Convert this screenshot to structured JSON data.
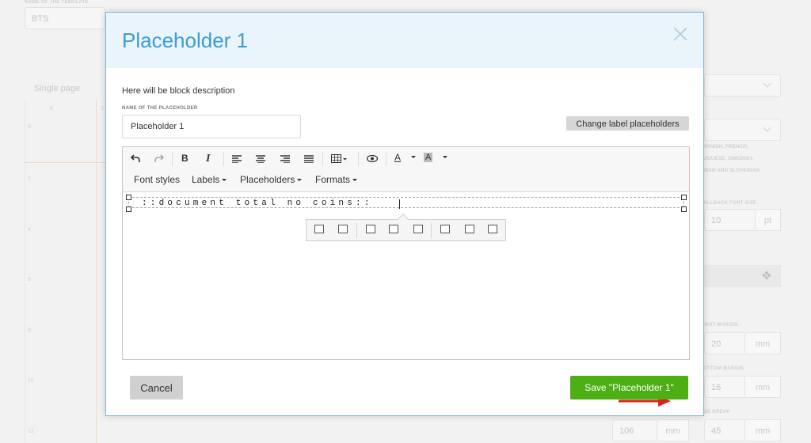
{
  "background": {
    "template_name_label": "NAME OF THE TEMPLATE",
    "template_name_value": "BTS",
    "page_mode": "Single page",
    "ruler_numbers": [
      "0",
      "2",
      "4",
      "6",
      "8",
      "10",
      "12"
    ],
    "ruler_top_numbers": [
      "0",
      "2"
    ],
    "languages_text": [
      "PANISH, FRENCH,",
      "UGUESE, SWEDISH,",
      "SIAN AND SLOVENIAN"
    ],
    "fallback_font_label": "ALLBACK FONT SIZE",
    "fallback_font_value": "10",
    "fallback_font_unit": "pt",
    "right_margin_label": "IGHT MARGIN",
    "right_margin_value": "20",
    "right_margin_unit": "mm",
    "bottom_margin_label": "OTTOM MARGIN",
    "bottom_margin_value": "16",
    "bottom_margin_unit": "mm",
    "page_break_label": "GE BREAK",
    "page_break_value": "45",
    "page_break_unit": "mm",
    "other_value": "106",
    "other_unit": "mm"
  },
  "modal": {
    "title": "Placeholder 1",
    "description": "Here will be block description",
    "name_label": "NAME OF THE PLACEHOLDER",
    "name_value": "Placeholder 1",
    "change_label_button": "Change label placeholders",
    "toolbar": {
      "bold": "B",
      "italic": "I",
      "font_color": "A",
      "bg_color": "A",
      "menus": [
        "Font styles",
        "Labels",
        "Placeholders",
        "Formats"
      ]
    },
    "editor_content": "::document total no coins::",
    "cancel_button": "Cancel",
    "save_button": "Save \"Placeholder 1\""
  },
  "colors": {
    "title": "#3d9bd8",
    "save_button": "#4caf14",
    "arrow": "#e02020"
  }
}
